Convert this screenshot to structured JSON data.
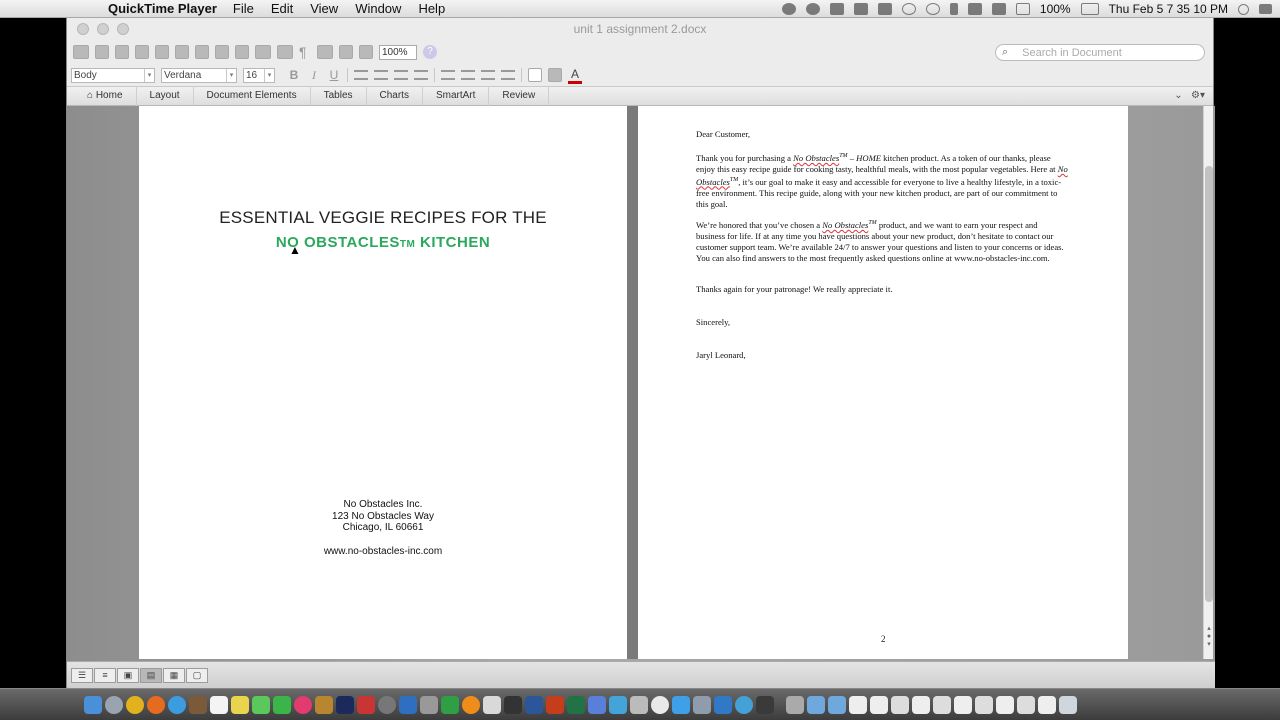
{
  "menubar": {
    "app_name": "QuickTime Player",
    "menus": [
      "File",
      "Edit",
      "View",
      "Window",
      "Help"
    ],
    "battery": "100%",
    "clock": "Thu Feb 5  7 35 10 PM",
    "apple_glyph": ""
  },
  "window": {
    "title": "unit 1 assignment 2.docx",
    "zoom": "100%",
    "search_placeholder": "Search in Document"
  },
  "format_bar": {
    "style": "Body",
    "font": "Verdana",
    "size": "16",
    "bold": "B",
    "italic": "I",
    "underline": "U",
    "font_color_glyph": "A"
  },
  "ribbon": {
    "tabs": [
      "Home",
      "Layout",
      "Document Elements",
      "Tables",
      "Charts",
      "SmartArt",
      "Review"
    ]
  },
  "page1": {
    "title": "ESSENTIAL VEGGIE RECIPES FOR THE",
    "brand_pre": "NO OBSTACLES",
    "brand_tm": "TM",
    "brand_post": " KITCHEN",
    "company": "No Obstacles Inc.",
    "street": "123 No Obstacles Way",
    "city": "Chicago, IL 60661",
    "website": "www.no-obstacles-inc.com"
  },
  "page2": {
    "greeting": "Dear Customer,",
    "p1_a": "Thank you for purchasing a ",
    "p1_brand": "No Obstacles",
    "p1_tm": "TM",
    "p1_b": " – HOME",
    "p1_c": " kitchen product. As a token of our thanks, please enjoy this easy recipe guide for cooking tasty, healthful meals, with the most popular vegetables. Here at ",
    "p1_brand2": "No Obstacles",
    "p1_tm2": "TM",
    "p1_d": ", it’s our goal to make it easy and accessible for everyone to live a healthy lifestyle, in a toxic-free environment. This recipe guide, along with your new kitchen product, are part of our commitment to this goal.",
    "p2_a": "We’re honored that you’ve chosen a ",
    "p2_brand": "No Obstacles",
    "p2_tm": "TM",
    "p2_b": " product, and we want to earn your respect and business for life. If at any time you have questions about your new product, don’t hesitate to contact our customer support team. We’re available 24/7 to answer your questions and listen to your concerns or ideas. You can also find answers to the most frequently asked questions online at www.no-obstacles-inc.com.",
    "p3": "Thanks again for your patronage! We really appreciate it.",
    "closing": "Sincerely,",
    "signature": "Jaryl Leonard,",
    "page_number": "2"
  },
  "colors": {
    "brand_green": "#2aa85c",
    "page_bg": "#ffffff",
    "canvas_gray": "#9a9a9a"
  }
}
